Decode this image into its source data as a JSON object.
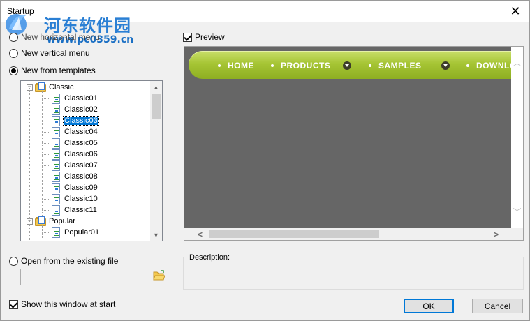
{
  "window": {
    "title": "Startup",
    "close_glyph": "✕"
  },
  "watermark": {
    "cn_text": "河东软件园",
    "url": "www.pc0359.cn"
  },
  "options": {
    "new_horizontal": "New horizontal menu",
    "new_vertical": "New vertical menu",
    "new_templates": "New from templates",
    "open_existing": "Open from the existing file",
    "selected": "new_templates"
  },
  "tree": {
    "groups": [
      {
        "label": "Classic",
        "expander": "−",
        "items": [
          "Classic01",
          "Classic02",
          "Classic03",
          "Classic04",
          "Classic05",
          "Classic06",
          "Classic07",
          "Classic08",
          "Classic09",
          "Classic10",
          "Classic11"
        ]
      },
      {
        "label": "Popular",
        "expander": "−",
        "items": [
          "Popular01"
        ]
      }
    ],
    "selected_item": "Classic03"
  },
  "file_input": {
    "value": ""
  },
  "show_window": {
    "label": "Show this window at start",
    "checked": true
  },
  "preview": {
    "label": "Preview",
    "checked": true,
    "menu": [
      {
        "label": "HOME",
        "has_arrow": false
      },
      {
        "label": "PRODUCTS",
        "has_arrow": true
      },
      {
        "label": "SAMPLES",
        "has_arrow": true
      },
      {
        "label": "DOWNLO",
        "has_arrow": false
      }
    ],
    "menu_color": "#a6c534"
  },
  "description": {
    "label": "Description:",
    "text": ""
  },
  "buttons": {
    "ok": "OK",
    "cancel": "Cancel"
  }
}
